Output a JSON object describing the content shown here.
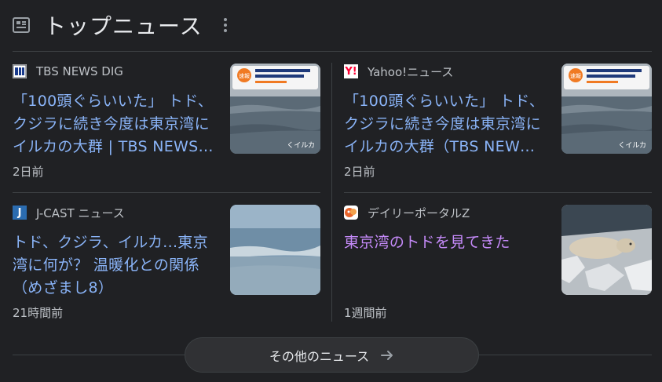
{
  "section": {
    "title": "トップニュース",
    "icon": "newspaper-icon",
    "menu_icon": "more-vert-icon"
  },
  "articles": [
    {
      "source": "TBS NEWS DIG",
      "headline": "「100頭ぐらいいた」 トド、クジラに続き今度は東京湾にイルカの大群 | TBS NEWS…",
      "time": "2日前",
      "visited": false,
      "thumbnail_caption": "くイルカ",
      "thumbnail_badge": "速報"
    },
    {
      "source": "Yahoo!ニュース",
      "headline": "「100頭ぐらいいた」 トド、クジラに続き今度は東京湾にイルカの大群（TBS NEW…",
      "time": "2日前",
      "visited": false,
      "thumbnail_caption": "くイルカ",
      "thumbnail_badge": "速報"
    },
    {
      "source": "J-CAST ニュース",
      "headline": "トド、クジラ、イルカ...東京湾に何が？ 温暖化との関係（めざまし8）",
      "time": "21時間前",
      "visited": false
    },
    {
      "source": "デイリーポータルZ",
      "headline": "東京湾のトドを見てきた",
      "time": "1週間前",
      "visited": true
    }
  ],
  "more_button": {
    "label": "その他のニュース",
    "icon": "arrow-right-icon"
  },
  "colors": {
    "background": "#202124",
    "link": "#8ab4f8",
    "visited_link": "#c58af9",
    "secondary_text": "#bdc1c6"
  }
}
